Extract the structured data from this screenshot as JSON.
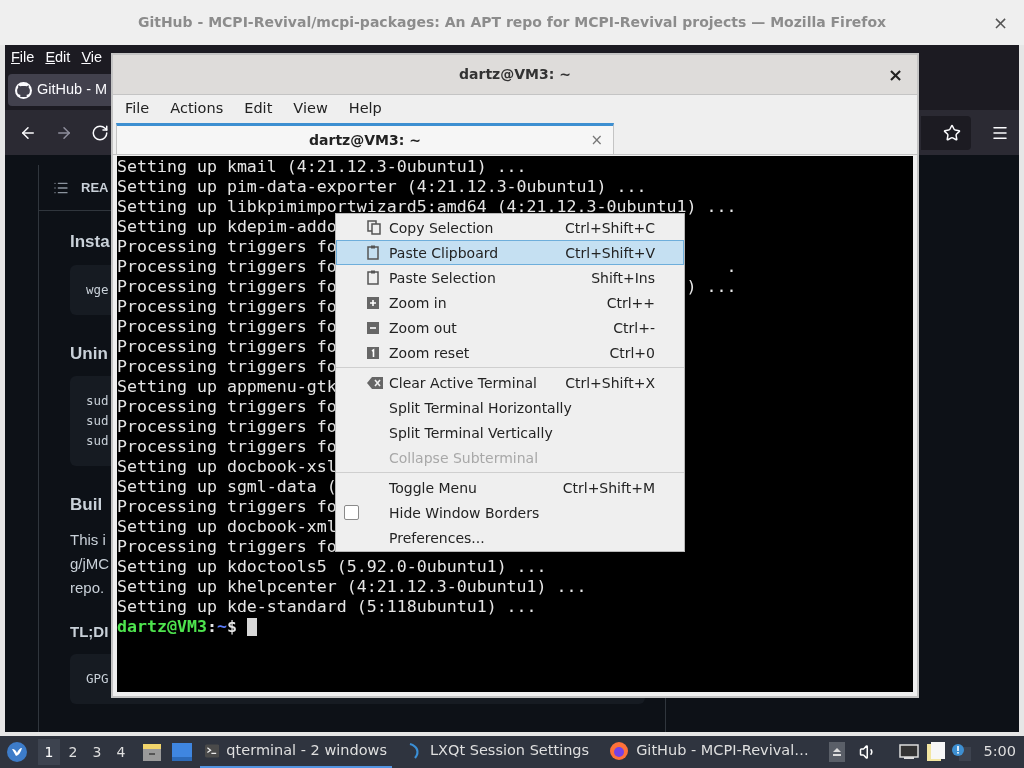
{
  "firefox": {
    "title": "GitHub - MCPI-Revival/mcpi-packages: An APT repo for MCPI-Revival projects — Mozilla Firefox",
    "close": "×",
    "menu": [
      "File",
      "Edit",
      "Vie"
    ],
    "tab": {
      "label": "GitHub - M"
    },
    "page": [
      {
        "kind": "header",
        "text": "REA"
      },
      {
        "kind": "heading",
        "text": "Insta"
      },
      {
        "kind": "code",
        "lines": [
          "wge"
        ]
      },
      {
        "kind": "heading",
        "text": "Unin"
      },
      {
        "kind": "code",
        "lines": [
          "sud",
          "sud",
          "sud"
        ]
      },
      {
        "kind": "heading",
        "text": "Buil"
      },
      {
        "kind": "paragraph",
        "lines": [
          "This i",
          "g/jMC",
          "repo."
        ]
      },
      {
        "kind": "subheading",
        "text": "TL;DI"
      },
      {
        "kind": "code",
        "lines": [
          "GPG"
        ]
      }
    ]
  },
  "terminal": {
    "title": "dartz@VM3: ~",
    "close": "×",
    "menu": [
      "File",
      "Actions",
      "Edit",
      "View",
      "Help"
    ],
    "tabs": [
      {
        "label": "dartz@VM3: ~",
        "selected": true,
        "close": "×"
      }
    ],
    "lines": [
      {
        "text": "Setting up kmail (4:21.12.3-0ubuntu1) ..."
      },
      {
        "text": "Setting up pim-data-exporter (4:21.12.3-0ubuntu1) ..."
      },
      {
        "text": "Setting up libkpimimportwizard5:amd64 (4:21.12.3-0ubuntu1) ..."
      },
      {
        "text": "Setting up kdepim-addo"
      },
      {
        "text": "Processing triggers fo"
      },
      {
        "text": "Processing triggers fo",
        "tail": "."
      },
      {
        "text": "Processing triggers fo",
        "tail": ") ..."
      },
      {
        "text": "Processing triggers fo"
      },
      {
        "text": "Processing triggers fo"
      },
      {
        "text": "Processing triggers fo"
      },
      {
        "text": "Processing triggers fo"
      },
      {
        "text": "Setting up appmenu-gtk"
      },
      {
        "text": "Processing triggers fo"
      },
      {
        "text": "Processing triggers fo"
      },
      {
        "text": "Processing triggers fo"
      },
      {
        "text": "Setting up docbook-xsl"
      },
      {
        "text": "Setting up sgml-data ("
      },
      {
        "text": "Processing triggers fo"
      },
      {
        "text": "Setting up docbook-xml"
      },
      {
        "text": "Processing triggers fo"
      },
      {
        "text": "Setting up kdoctools5 (5.92.0-0ubuntu1) ..."
      },
      {
        "text": "Setting up khelpcenter (4:21.12.3-0ubuntu1) ..."
      },
      {
        "text": "Setting up kde-standard (5:118ubuntu1) ..."
      }
    ],
    "prompt": {
      "host": "dartz@VM3",
      "colon": ":",
      "path": "~",
      "symbol": "$"
    },
    "context_menu": {
      "groups": [
        [
          {
            "kind": "copy",
            "label": "Copy Selection",
            "shortcut": "Ctrl+Shift+C",
            "selected": false,
            "disabled": false
          },
          {
            "kind": "paste",
            "label": "Paste Clipboard",
            "shortcut": "Ctrl+Shift+V",
            "selected": true,
            "disabled": false
          },
          {
            "kind": "paste",
            "label": "Paste Selection",
            "shortcut": "Shift+Ins",
            "selected": false,
            "disabled": false
          },
          {
            "kind": "zoomin",
            "label": "Zoom in",
            "shortcut": "Ctrl++",
            "selected": false,
            "disabled": false
          },
          {
            "kind": "zoomout",
            "label": "Zoom out",
            "shortcut": "Ctrl+-",
            "selected": false,
            "disabled": false
          },
          {
            "kind": "zoomreset",
            "label": "Zoom reset",
            "shortcut": "Ctrl+0",
            "selected": false,
            "disabled": false
          }
        ],
        [
          {
            "kind": "clear",
            "label": "Clear Active Terminal",
            "shortcut": "Ctrl+Shift+X",
            "selected": false,
            "disabled": false
          },
          {
            "kind": "plain",
            "label": "Split Terminal Horizontally",
            "selected": false,
            "disabled": false
          },
          {
            "kind": "plain",
            "label": "Split Terminal Vertically",
            "selected": false,
            "disabled": false
          },
          {
            "kind": "plain",
            "label": "Collapse Subterminal",
            "selected": false,
            "disabled": true
          }
        ],
        [
          {
            "kind": "plain",
            "label": "Toggle Menu",
            "shortcut": "Ctrl+Shift+M",
            "selected": false,
            "disabled": false
          },
          {
            "kind": "checkbox",
            "label": "Hide Window Borders",
            "checked": false,
            "selected": false,
            "disabled": false
          },
          {
            "kind": "plain",
            "label": "Preferences...",
            "selected": false,
            "disabled": false
          }
        ]
      ]
    }
  },
  "taskbar": {
    "desktops": [
      {
        "label": "1",
        "selected": true
      },
      {
        "label": "2",
        "selected": false
      },
      {
        "label": "3",
        "selected": false
      },
      {
        "label": "4",
        "selected": false
      }
    ],
    "tasks": [
      {
        "kind": "terminal",
        "label": "qterminal - 2 windows",
        "selected": true
      },
      {
        "kind": "session",
        "label": "LXQt Session Settings",
        "selected": false
      },
      {
        "kind": "browser",
        "label": "GitHub - MCPI-Revival…",
        "selected": false
      }
    ],
    "clock": "5:00"
  }
}
